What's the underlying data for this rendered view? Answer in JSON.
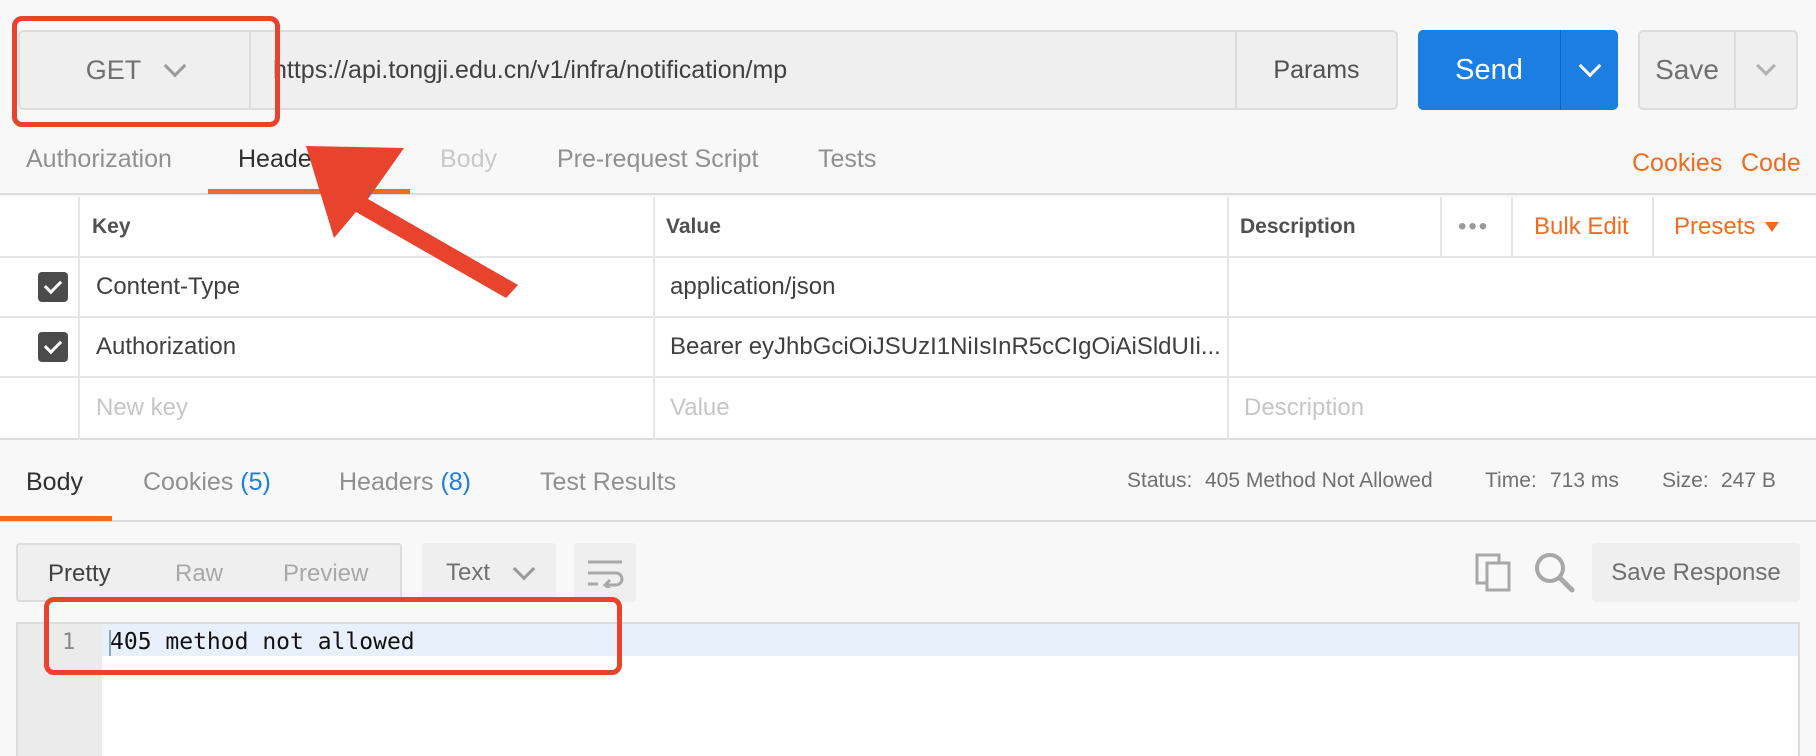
{
  "request": {
    "method": "GET",
    "url": "https://api.tongji.edu.cn/v1/infra/notification/mp",
    "params_label": "Params",
    "send_label": "Send",
    "save_label": "Save"
  },
  "request_tabs": {
    "authorization": "Authorization",
    "headers": "Heade",
    "body": "Body",
    "pre_request": "Pre-request Script",
    "tests": "Tests",
    "cookies": "Cookies",
    "code": "Code"
  },
  "headers_table": {
    "col_key": "Key",
    "col_value": "Value",
    "col_description": "Description",
    "more": "•••",
    "bulk_edit": "Bulk Edit",
    "presets": "Presets",
    "rows": [
      {
        "key": "Content-Type",
        "value": "application/json"
      },
      {
        "key": "Authorization",
        "value": "Bearer eyJhbGciOiJSUzI1NiIsInR5cCIgOiAiSldUIi..."
      }
    ],
    "new_key_placeholder": "New key",
    "value_placeholder": "Value",
    "description_placeholder": "Description"
  },
  "response_tabs": {
    "body": "Body",
    "cookies": "Cookies",
    "cookies_count": "(5)",
    "headers": "Headers",
    "headers_count": "(8)",
    "test_results": "Test Results"
  },
  "response_meta": {
    "status_label": "Status:",
    "status_value": "405 Method Not Allowed",
    "time_label": "Time:",
    "time_value": "713 ms",
    "size_label": "Size:",
    "size_value": "247 B"
  },
  "response_toolbar": {
    "pretty": "Pretty",
    "raw": "Raw",
    "preview": "Preview",
    "format": "Text",
    "save_response": "Save Response"
  },
  "editor": {
    "line_number": "1",
    "content": "405 method not allowed"
  },
  "colors": {
    "accent_orange": "#f26b21",
    "send_blue": "#1b7ee0",
    "annotation_red": "#e8432d"
  }
}
